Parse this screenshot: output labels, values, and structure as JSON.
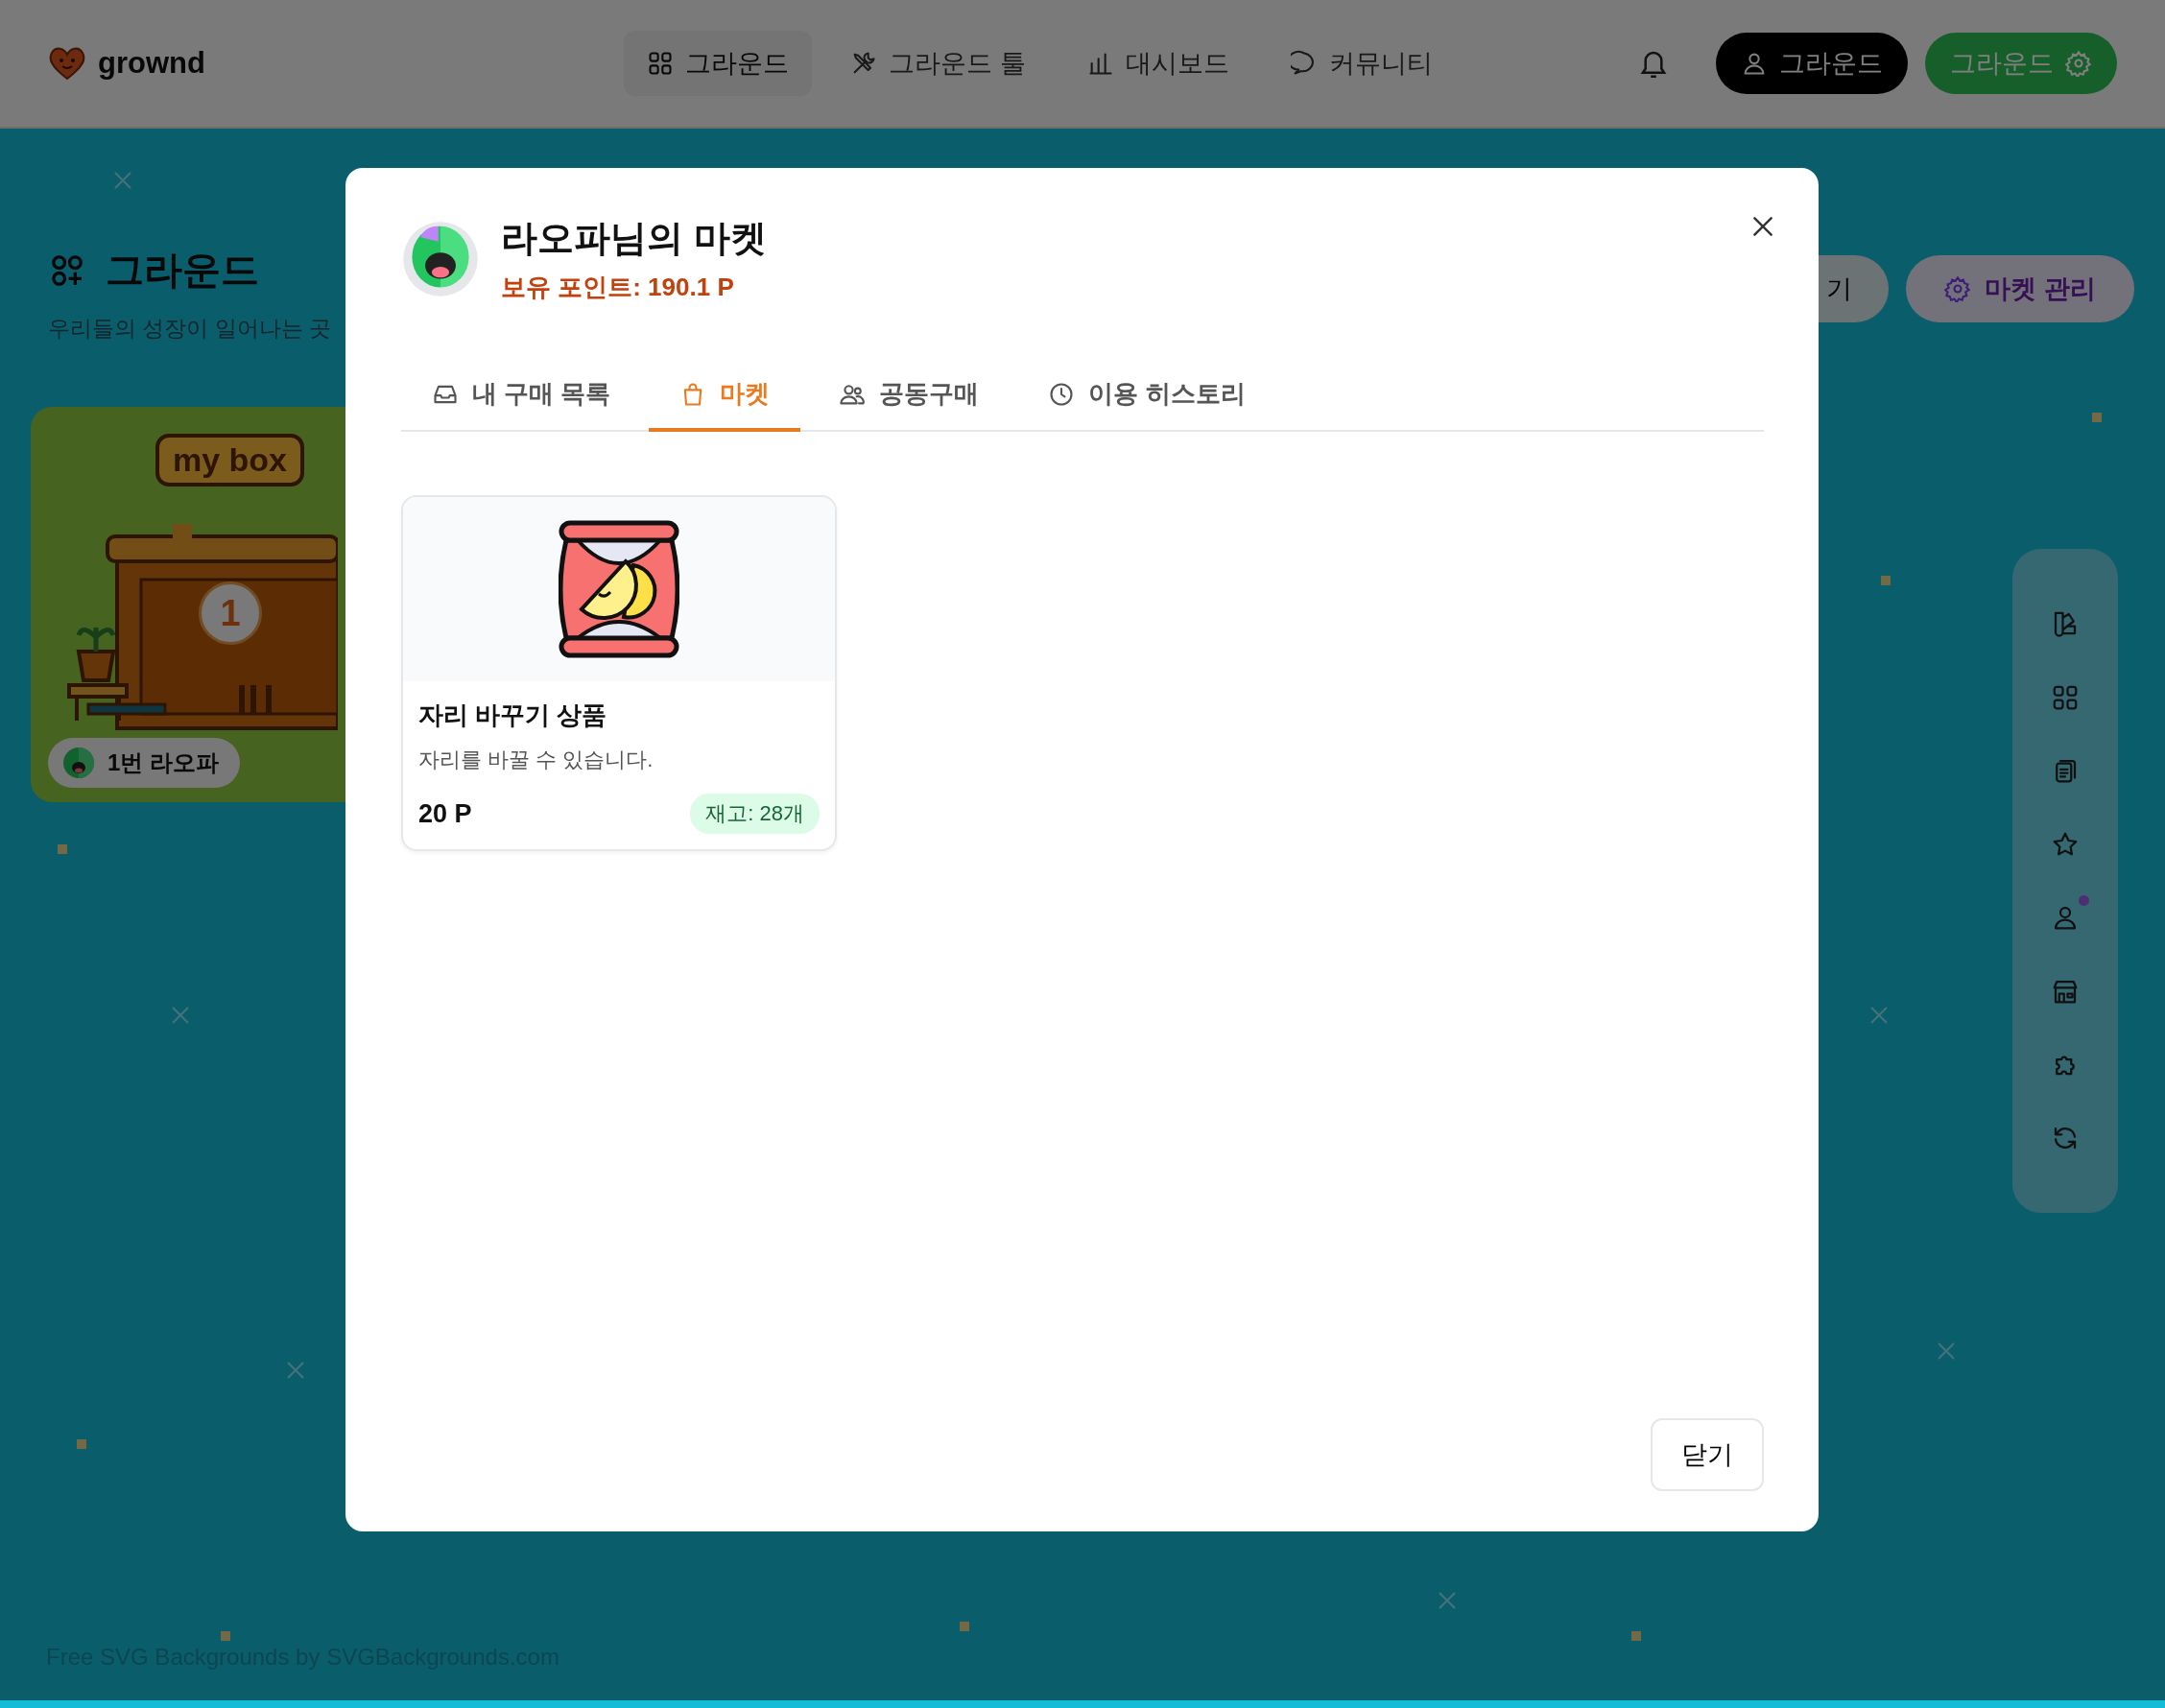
{
  "header": {
    "logo": "grownd",
    "nav": [
      {
        "label": "그라운드",
        "kind": "grid",
        "selected": true
      },
      {
        "label": "그라운드 툴",
        "kind": "tools",
        "selected": false
      },
      {
        "label": "대시보드",
        "kind": "chart",
        "selected": false
      },
      {
        "label": "커뮤니티",
        "kind": "chat",
        "selected": false
      }
    ],
    "account_button": "그라운드",
    "ground_button": "그라운드"
  },
  "page": {
    "title": "그라운드",
    "subtitle": "우리들의 성장이 일어나는 곳",
    "exit_button": "기",
    "manage_button": "마켓 관리",
    "box_card": {
      "sign": "my box",
      "number": "1",
      "owner": "1번 라오파"
    },
    "tools": [
      {
        "kind": "swatch",
        "notify": false
      },
      {
        "kind": "grid",
        "notify": false
      },
      {
        "kind": "clipboard",
        "notify": false
      },
      {
        "kind": "star",
        "notify": false
      },
      {
        "kind": "person",
        "notify": true
      },
      {
        "kind": "store",
        "notify": false
      },
      {
        "kind": "puzzle",
        "notify": false
      },
      {
        "kind": "refresh",
        "notify": false
      }
    ],
    "credit": "Free SVG Backgrounds by SVGBackgrounds.com"
  },
  "modal": {
    "title": "라오파님의 마켓",
    "points": "보유 포인트: 190.1 P",
    "tabs": [
      {
        "label": "내 구매 목록",
        "kind": "inbox",
        "selected": false
      },
      {
        "label": "마켓",
        "kind": "bag",
        "selected": true
      },
      {
        "label": "공동구매",
        "kind": "people",
        "selected": false
      },
      {
        "label": "이용 히스토리",
        "kind": "clock",
        "selected": false
      }
    ],
    "products": [
      {
        "name": "자리 바꾸기 상품",
        "description": "자리를 바꿀 수 있습니다.",
        "price": "20 P",
        "stock": "재고: 28개"
      }
    ],
    "close_button": "닫기"
  }
}
